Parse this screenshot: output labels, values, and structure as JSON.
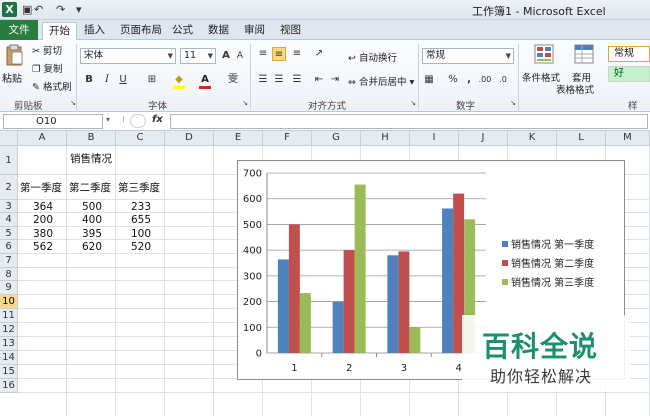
{
  "app": {
    "title": "工作簿1 - Microsoft Excel",
    "logo": "X",
    "quick_access": [
      "↶",
      "↷",
      "▾"
    ]
  },
  "tabs": [
    "文件",
    "开始",
    "插入",
    "页面布局",
    "公式",
    "数据",
    "审阅",
    "视图"
  ],
  "ribbon": {
    "clipboard": {
      "paste": "粘贴",
      "cut": "剪切",
      "copy": "复制",
      "format_painter": "格式刷",
      "label": "剪贴板"
    },
    "font": {
      "font_name": "宋体",
      "font_size": "11",
      "bold": "B",
      "italic": "I",
      "underline": "U",
      "grow": "A",
      "shrink": "A",
      "label": "字体"
    },
    "alignment": {
      "wrap": "自动换行",
      "merge": "合并后居中",
      "label": "对齐方式"
    },
    "number": {
      "format": "常规",
      "percent": "%",
      "comma": ",",
      "label": "数字"
    },
    "styles": {
      "cond_format": "条件格式",
      "table_format_1": "套用",
      "table_format_2": "表格格式",
      "normal": "常规",
      "good": "好",
      "label": "样"
    }
  },
  "formula_bar": {
    "name_box": "O10",
    "fx": "fx"
  },
  "columns": [
    "A",
    "B",
    "C",
    "D",
    "E",
    "F",
    "G",
    "H",
    "I",
    "J",
    "K",
    "L",
    "M"
  ],
  "rows": [
    "1",
    "2",
    "3",
    "4",
    "5",
    "6",
    "7",
    "8",
    "9",
    "10",
    "11",
    "12",
    "13",
    "14",
    "15",
    "16"
  ],
  "selected_row": "10",
  "sheet": {
    "title": "销售情况",
    "headers": [
      "第一季度",
      "第二季度",
      "第三季度"
    ],
    "data": [
      [
        "364",
        "500",
        "233"
      ],
      [
        "200",
        "400",
        "655"
      ],
      [
        "380",
        "395",
        "100"
      ],
      [
        "562",
        "620",
        "520"
      ]
    ]
  },
  "chart_data": {
    "type": "bar",
    "categories": [
      "1",
      "2",
      "3",
      "4"
    ],
    "series": [
      {
        "name": "销售情况 第一季度",
        "values": [
          364,
          200,
          380,
          562
        ],
        "color": "#4f81bd"
      },
      {
        "name": "销售情况 第二季度",
        "values": [
          500,
          400,
          395,
          620
        ],
        "color": "#c0504d"
      },
      {
        "name": "销售情况 第三季度",
        "values": [
          233,
          655,
          100,
          520
        ],
        "color": "#9bbb59"
      }
    ],
    "yticks": [
      "0",
      "100",
      "200",
      "300",
      "400",
      "500",
      "600",
      "700"
    ],
    "ylim": [
      0,
      700
    ],
    "grid": true,
    "legend": "right"
  },
  "watermark": {
    "title": "百科全说",
    "subtitle": "助你轻松解决"
  }
}
